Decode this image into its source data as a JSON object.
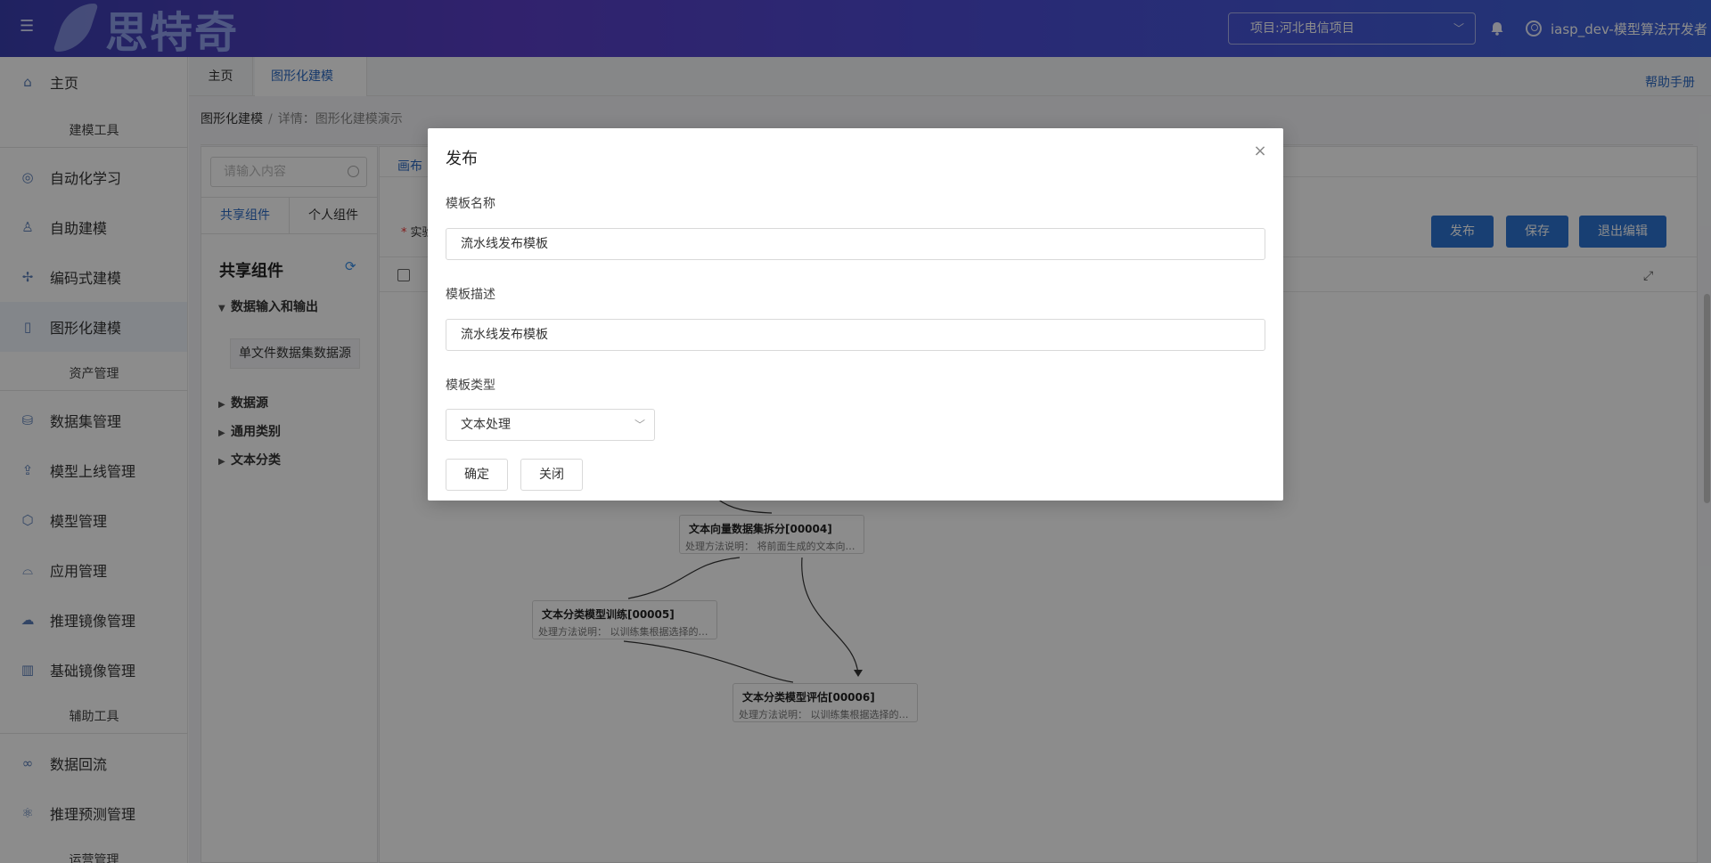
{
  "header": {
    "logo_text": "思特奇",
    "project_label": "项目:河北电信项目",
    "username": "iasp_dev-模型算法开发者"
  },
  "sidebar": {
    "home": "主页",
    "group_modeling": "建模工具",
    "auto_learning": "自动化学习",
    "self_modeling": "自助建模",
    "code_modeling": "编码式建模",
    "graph_modeling": "图形化建模",
    "group_assets": "资产管理",
    "dataset_mgmt": "数据集管理",
    "model_deploy_mgmt": "模型上线管理",
    "model_mgmt": "模型管理",
    "app_mgmt": "应用管理",
    "infer_image_mgmt": "推理镜像管理",
    "base_image_mgmt": "基础镜像管理",
    "group_aux": "辅助工具",
    "data_backflow": "数据回流",
    "infer_predict_mgmt": "推理预测管理",
    "group_ops": "运营管理"
  },
  "tabs": {
    "home": "主页",
    "active": "图形化建模",
    "close": "×",
    "help": "帮助手册"
  },
  "breadcrumb": {
    "root": "图形化建模",
    "sep": "/",
    "current": "详情：图形化建模演示"
  },
  "left_panel": {
    "search_placeholder": "请输入内容",
    "tab_shared": "共享组件",
    "tab_personal": "个人组件",
    "title": "共享组件",
    "tree": {
      "data_io": "数据输入和输出",
      "leaf_single_file": "单文件数据集数据源",
      "datasource": "数据源",
      "common_category": "通用类别",
      "text_classification": "文本分类"
    }
  },
  "canvas": {
    "tab_label": "画布",
    "exp_label": "实验",
    "publish_btn": "发布",
    "save_btn": "保存",
    "exit_btn": "退出编辑",
    "nodes": [
      {
        "title": "文本向量数据集拆分[00004]",
        "desc": "处理方法说明：  将前面生成的文本向量数据集拆分"
      },
      {
        "title": "文本分类模型训练[00005]",
        "desc": "处理方法说明：  以训练集根据选择的算法进行训练"
      },
      {
        "title": "文本分类模型评估[00006]",
        "desc": "处理方法说明：  以训练集根据选择的算法进行评估"
      }
    ]
  },
  "modal": {
    "title": "发布",
    "name_label": "模板名称",
    "name_value": "流水线发布模板",
    "desc_label": "模板描述",
    "desc_value": "流水线发布模板",
    "type_label": "模板类型",
    "type_value": "文本处理",
    "confirm_btn": "确定",
    "close_btn": "关闭"
  }
}
